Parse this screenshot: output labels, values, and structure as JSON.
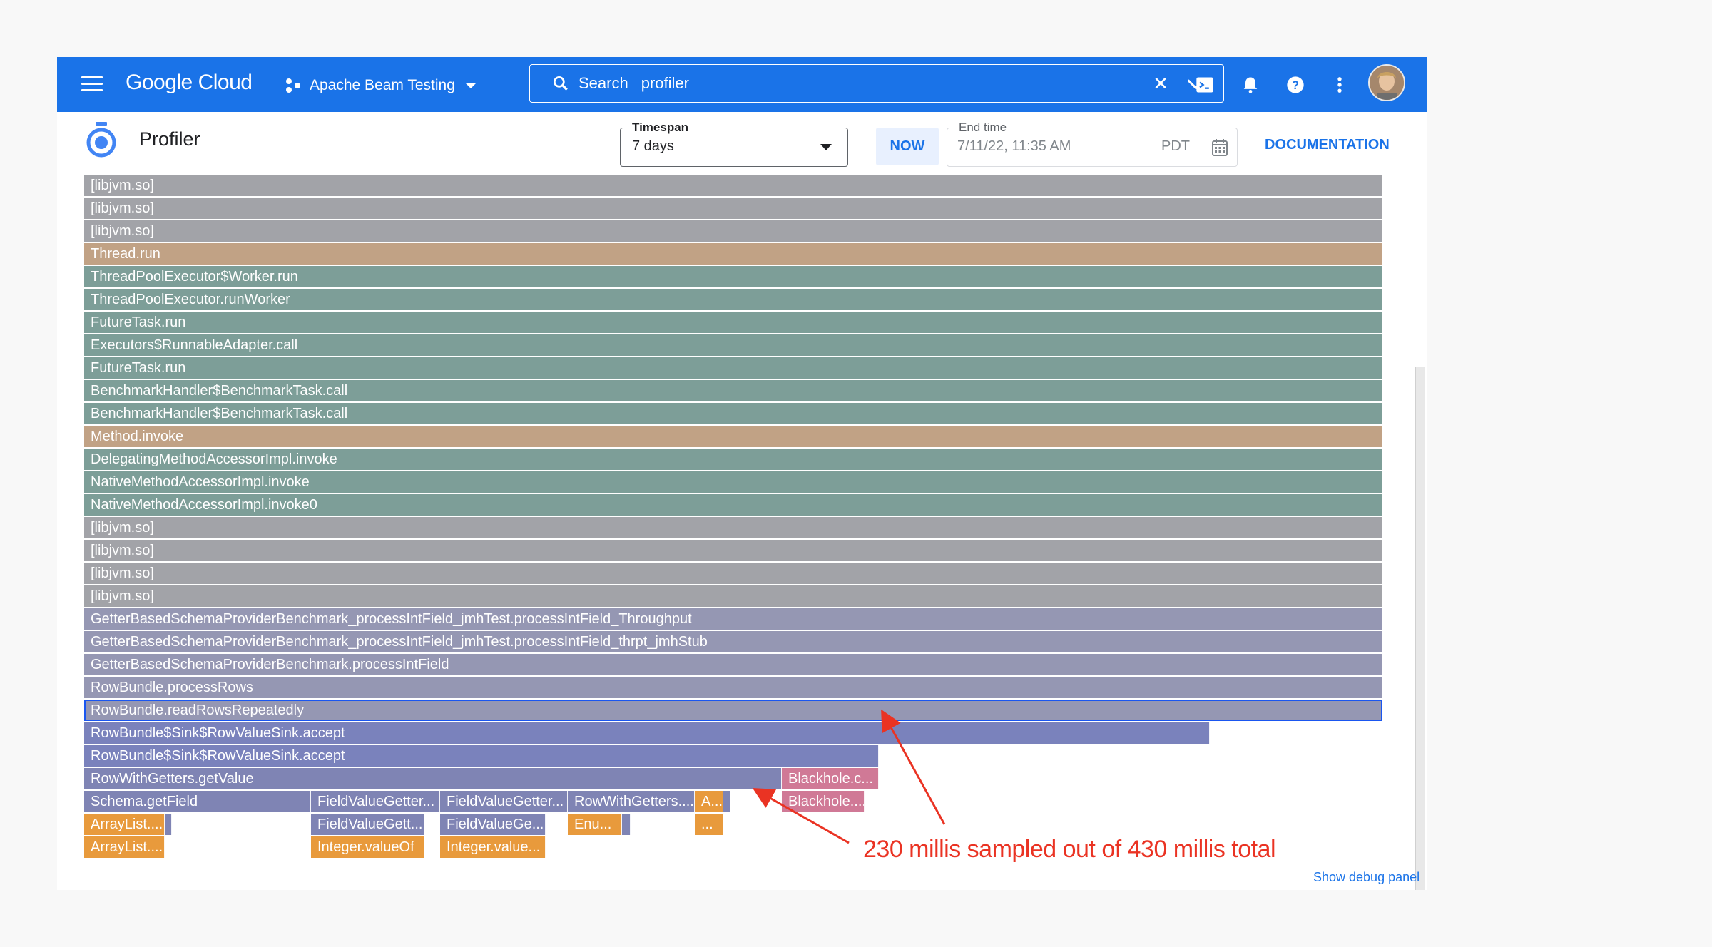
{
  "topbar": {
    "logo": "Google Cloud",
    "project": "Apache Beam Testing",
    "search_label": "Search",
    "search_query": "profiler",
    "icons": [
      "menu-icon",
      "project-icon",
      "search-icon",
      "clear-icon",
      "chevron-down-icon",
      "terminal-icon",
      "bell-icon",
      "help-icon",
      "more-vert-icon",
      "avatar"
    ]
  },
  "header": {
    "title": "Profiler",
    "timespan_label": "Timespan",
    "timespan_value": "7 days",
    "now_label": "NOW",
    "endtime_label": "End time",
    "endtime_value": "7/11/22, 11:35 AM",
    "endtime_tz": "PDT",
    "documentation": "DOCUMENTATION"
  },
  "colors": {
    "accent": "#1a73e8",
    "native": "#a2a3a8",
    "jdk": "#c1a285",
    "pool": "#7d9e98",
    "bench": "#9597b3",
    "beam": "#7a82bc",
    "get": "#7f84b4",
    "hole": "#d07996",
    "box": "#e89a3c",
    "annotation": "#ea3323"
  },
  "flame": {
    "total_width": 1820,
    "frames": [
      {
        "l": "[libjvm.so]",
        "d": 0,
        "s": 0,
        "w": 1820,
        "c": "native"
      },
      {
        "l": "[libjvm.so]",
        "d": 1,
        "s": 0,
        "w": 1820,
        "c": "native"
      },
      {
        "l": "[libjvm.so]",
        "d": 2,
        "s": 0,
        "w": 1820,
        "c": "native"
      },
      {
        "l": "Thread.run",
        "d": 3,
        "s": 0,
        "w": 1820,
        "c": "jdk"
      },
      {
        "l": "ThreadPoolExecutor$Worker.run",
        "d": 4,
        "s": 0,
        "w": 1820,
        "c": "pool"
      },
      {
        "l": "ThreadPoolExecutor.runWorker",
        "d": 5,
        "s": 0,
        "w": 1820,
        "c": "pool"
      },
      {
        "l": "FutureTask.run",
        "d": 6,
        "s": 0,
        "w": 1820,
        "c": "pool"
      },
      {
        "l": "Executors$RunnableAdapter.call",
        "d": 7,
        "s": 0,
        "w": 1820,
        "c": "pool"
      },
      {
        "l": "FutureTask.run",
        "d": 8,
        "s": 0,
        "w": 1820,
        "c": "pool"
      },
      {
        "l": "BenchmarkHandler$BenchmarkTask.call",
        "d": 9,
        "s": 0,
        "w": 1820,
        "c": "pool"
      },
      {
        "l": "BenchmarkHandler$BenchmarkTask.call",
        "d": 10,
        "s": 0,
        "w": 1820,
        "c": "pool"
      },
      {
        "l": "Method.invoke",
        "d": 11,
        "s": 0,
        "w": 1820,
        "c": "jdk"
      },
      {
        "l": "DelegatingMethodAccessorImpl.invoke",
        "d": 12,
        "s": 0,
        "w": 1820,
        "c": "pool"
      },
      {
        "l": "NativeMethodAccessorImpl.invoke",
        "d": 13,
        "s": 0,
        "w": 1820,
        "c": "pool"
      },
      {
        "l": "NativeMethodAccessorImpl.invoke0",
        "d": 14,
        "s": 0,
        "w": 1820,
        "c": "pool"
      },
      {
        "l": "[libjvm.so]",
        "d": 15,
        "s": 0,
        "w": 1820,
        "c": "native"
      },
      {
        "l": "[libjvm.so]",
        "d": 16,
        "s": 0,
        "w": 1820,
        "c": "native"
      },
      {
        "l": "[libjvm.so]",
        "d": 17,
        "s": 0,
        "w": 1820,
        "c": "native"
      },
      {
        "l": "[libjvm.so]",
        "d": 18,
        "s": 0,
        "w": 1820,
        "c": "native"
      },
      {
        "l": "GetterBasedSchemaProviderBenchmark_processIntField_jmhTest.processIntField_Throughput",
        "d": 19,
        "s": 0,
        "w": 1820,
        "c": "bench"
      },
      {
        "l": "GetterBasedSchemaProviderBenchmark_processIntField_jmhTest.processIntField_thrpt_jmhStub",
        "d": 20,
        "s": 0,
        "w": 1820,
        "c": "bench"
      },
      {
        "l": "GetterBasedSchemaProviderBenchmark.processIntField",
        "d": 21,
        "s": 0,
        "w": 1820,
        "c": "bench"
      },
      {
        "l": "RowBundle.processRows",
        "d": 22,
        "s": 0,
        "w": 1820,
        "c": "bench"
      },
      {
        "l": "RowBundle.readRowsRepeatedly",
        "d": 23,
        "s": 0,
        "w": 1820,
        "c": "bench",
        "sel": true
      },
      {
        "l": "RowBundle$Sink$RowValueSink.accept",
        "d": 24,
        "s": 0,
        "w": 1578,
        "c": "beam"
      },
      {
        "l": "RowBundle$Sink$RowValueSink.accept",
        "d": 25,
        "s": 0,
        "w": 1114,
        "c": "beam"
      },
      {
        "l": "RowWithGetters.getValue",
        "d": 26,
        "s": 0,
        "w": 978,
        "c": "get"
      },
      {
        "l": "Blackhole.c...",
        "d": 26,
        "s": 978,
        "w": 136,
        "c": "hole"
      },
      {
        "l": "Schema.getField",
        "d": 27,
        "s": 0,
        "w": 318,
        "c": "get"
      },
      {
        "l": "FieldValueGetter...",
        "d": 27,
        "s": 318,
        "w": 181,
        "c": "get"
      },
      {
        "l": "FieldValueGetter...",
        "d": 27,
        "s": 499,
        "w": 179,
        "c": "get"
      },
      {
        "l": "RowWithGetters....",
        "d": 27,
        "s": 678,
        "w": 178,
        "c": "get"
      },
      {
        "l": "A...",
        "d": 27,
        "s": 856,
        "w": 40,
        "c": "box"
      },
      {
        "l": "",
        "d": 27,
        "s": 896,
        "w": 10,
        "c": "get"
      },
      {
        "l": "Blackhole....",
        "d": 27,
        "s": 978,
        "w": 116,
        "c": "hole"
      },
      {
        "l": "ArrayList....",
        "d": 28,
        "s": 0,
        "w": 113,
        "c": "box"
      },
      {
        "l": "",
        "d": 28,
        "s": 113,
        "w": 6,
        "c": "get"
      },
      {
        "l": "FieldValueGett...",
        "d": 28,
        "s": 318,
        "w": 159,
        "c": "get"
      },
      {
        "l": "FieldValueGe...",
        "d": 28,
        "s": 499,
        "w": 148,
        "c": "get"
      },
      {
        "l": "Enu...",
        "d": 28,
        "s": 678,
        "w": 76,
        "c": "box"
      },
      {
        "l": "",
        "d": 28,
        "s": 754,
        "w": 12,
        "c": "get"
      },
      {
        "l": "...",
        "d": 28,
        "s": 856,
        "w": 40,
        "c": "box"
      },
      {
        "l": "ArrayList....",
        "d": 29,
        "s": 0,
        "w": 113,
        "c": "box"
      },
      {
        "l": "Integer.valueOf",
        "d": 29,
        "s": 318,
        "w": 159,
        "c": "box"
      },
      {
        "l": "Integer.value...",
        "d": 29,
        "s": 499,
        "w": 148,
        "c": "box"
      }
    ]
  },
  "footer": {
    "debug_link": "Show debug panel",
    "annotation": "230 millis sampled out of 430 millis total"
  }
}
